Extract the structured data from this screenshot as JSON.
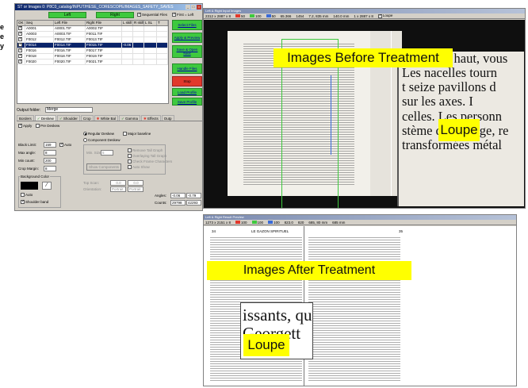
{
  "side_caption": [
    "e",
    "e",
    "y"
  ],
  "settings_window": {
    "title": "ST or Images 0: P8C0_catalog/INPUT/HESE_CORESCOPE/IMAGES_SAFETY_SAVES",
    "left_button": "Left",
    "right_button": "Right",
    "sequential_files_label": "Sequential Files",
    "first_left_label": "First = Left",
    "grid_headers": [
      "OK",
      "Seq",
      "Left File",
      "Right File",
      "L skill",
      "R skill",
      "L SL",
      "T"
    ],
    "rows": [
      {
        "seq": "A0001",
        "left": "A0001.TIF",
        "right": "A0002.TIF",
        "extra": "",
        "selected": false
      },
      {
        "seq": "A0003",
        "left": "A0003.TIF",
        "right": "F0011.TIF",
        "extra": "",
        "selected": false
      },
      {
        "seq": "F0012",
        "left": "F0012.TIF",
        "right": "F0013.TIF",
        "extra": "",
        "selected": false
      },
      {
        "seq": "F0014",
        "left": "F0014.TIF",
        "right": "F0015.TIF",
        "extra": "-0.06",
        "selected": true
      },
      {
        "seq": "F0016",
        "left": "F0016.TIF",
        "right": "F0017.TIF",
        "extra": "",
        "selected": false
      },
      {
        "seq": "F0018",
        "left": "F0018.TIF",
        "right": "F0019.TIF",
        "extra": "",
        "selected": false
      },
      {
        "seq": "F0020",
        "left": "F0020.TIF",
        "right": "F0021.TIF",
        "extra": "",
        "selected": false
      }
    ],
    "side_buttons": [
      "Select Files",
      "Apply & Preview",
      "Save & Open Next",
      "Handle Files",
      "Stop",
      "Load Profile",
      "Save Profile"
    ],
    "output_folder_label": "Output folder:",
    "output_folder_value": "Merge",
    "tabs": [
      "Borders",
      "Deskew",
      "Shoulder",
      "Crop",
      "White Bal",
      "Gamma",
      "Effects",
      "Outp"
    ],
    "apply_label": "Apply",
    "pre_deskew_label": "Pre Deskew",
    "black_limit_label": "Black Limit:",
    "black_limit_value": "159",
    "auto_label": "Auto",
    "max_angle_label": "Max angle:",
    "max_angle_value": "8",
    "min_count_label": "Min count:",
    "min_count_value": "200",
    "crop_margin_label": "Crop Margin:",
    "crop_margin_value": "8",
    "background_color_label": "Background Color",
    "auto2_label": "Auto",
    "shoulder_band_label": "Shoulder band",
    "regular_deskew_label": "Regular Deskew",
    "major_baseline_label": "Major baseline",
    "component_deskew_label": "Component Deskew",
    "min_size_label": "Min. Size",
    "min_size_value": "5",
    "remove_tall_label": "Remove Tall Graph",
    "overlaying_label": "Overlaying Tall Graph",
    "check_frame_label": "Check Frame Characters",
    "auto_show_label": "Auto Show",
    "show_components_label": "Show Components",
    "top_scan_label": "Top Scan:",
    "top_scan_values": [
      "0.0",
      "0.0"
    ],
    "orientation_label": "Orientation:",
    "orientation_values": [
      "Portrait",
      "Portrait"
    ],
    "angles_label": "Angles:",
    "angles_values": [
      "-0.06",
      "-0.79"
    ],
    "counts_label": "Counts:",
    "counts_values": [
      "29798",
      "42293"
    ]
  },
  "before_window": {
    "title": "Left & Right Input Images",
    "status": [
      "2312 x 2887 x 8",
      "50",
      "100",
      "50",
      "65.366",
      "1454",
      "7.2, 835 mm",
      "140.0 mm",
      "1 x 2887 x 8"
    ],
    "loupe_checkbox": "Loupe",
    "label": "Images Before Treatment",
    "loupe_label": "Loupe",
    "loupe_text": [
      "de bas en haut, vous",
      "Les nacelles tourn",
      "t seize pavillons d",
      "sur les axes. I",
      "celles. Les personn",
      "stème d'éclairage, re",
      "transformées métal"
    ]
  },
  "after_window": {
    "title": "Left & Right Result Preview",
    "status": [
      "1273 x 2151 x 8",
      "100",
      "100",
      "100",
      "823.0",
      "820",
      "685, 80 mm",
      "685 mm"
    ],
    "label": "Images After Treatment",
    "loupe_label": "Loupe",
    "loupe_text": [
      "issants, qu",
      "Georgett"
    ],
    "page_header_left": "LE GAZON SPIRITUEL",
    "page_number_left": "34",
    "page_number_right": "35"
  },
  "colors": {
    "green_button": "#3ec93e",
    "red_button": "#e2392c",
    "highlight": "#ffff00",
    "selection": "#0a246a"
  }
}
